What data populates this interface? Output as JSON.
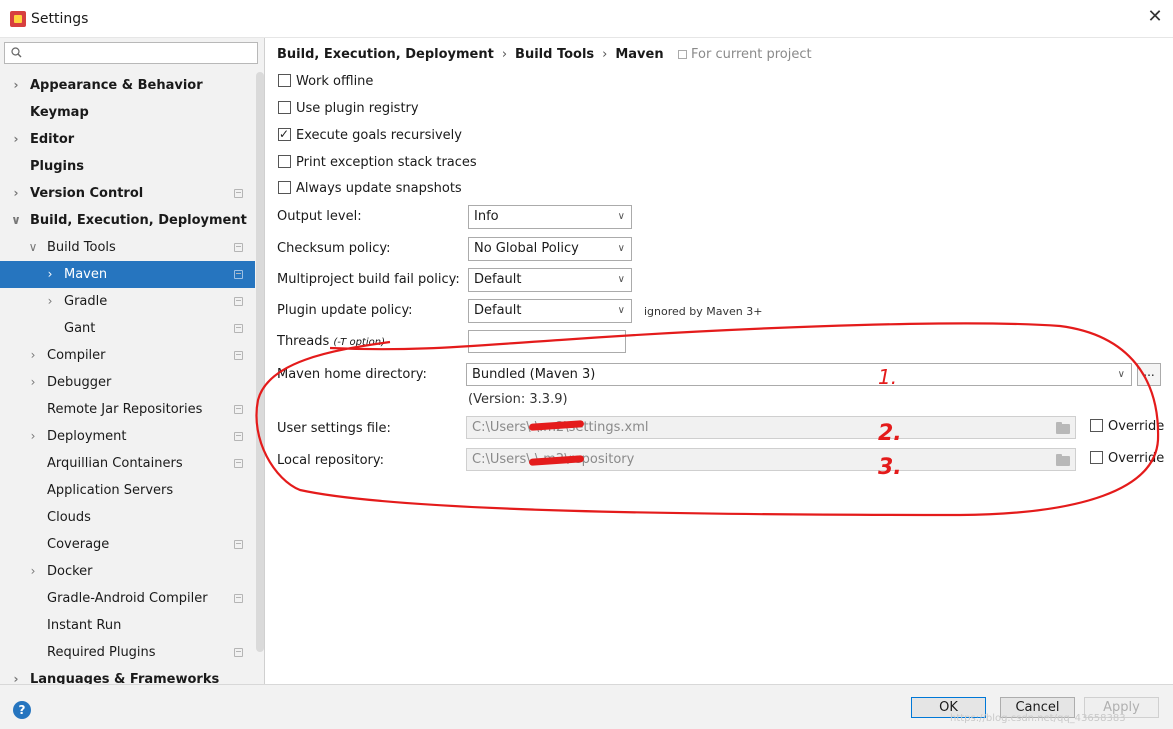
{
  "window": {
    "title": "Settings",
    "close_glyph": "✕"
  },
  "sidebar": {
    "search_placeholder": "",
    "items": [
      {
        "label": "Appearance & Behavior",
        "arrow": "›",
        "bold": true,
        "indent": 0
      },
      {
        "label": "Keymap",
        "arrow": "",
        "bold": true,
        "indent": 0
      },
      {
        "label": "Editor",
        "arrow": "›",
        "bold": true,
        "indent": 0
      },
      {
        "label": "Plugins",
        "arrow": "",
        "bold": true,
        "indent": 0
      },
      {
        "label": "Version Control",
        "arrow": "›",
        "bold": true,
        "indent": 0,
        "project": true
      },
      {
        "label": "Build, Execution, Deployment",
        "arrow": "⌄",
        "bold": true,
        "indent": 0
      },
      {
        "label": "Build Tools",
        "arrow": "⌄",
        "bold": false,
        "indent": 1,
        "project": true
      },
      {
        "label": "Maven",
        "arrow": "›",
        "bold": false,
        "indent": 2,
        "project": true,
        "selected": true
      },
      {
        "label": "Gradle",
        "arrow": "›",
        "bold": false,
        "indent": 2,
        "project": true
      },
      {
        "label": "Gant",
        "arrow": "",
        "bold": false,
        "indent": 2,
        "project": true
      },
      {
        "label": "Compiler",
        "arrow": "›",
        "bold": false,
        "indent": 1,
        "project": true
      },
      {
        "label": "Debugger",
        "arrow": "›",
        "bold": false,
        "indent": 1
      },
      {
        "label": "Remote Jar Repositories",
        "arrow": "",
        "bold": false,
        "indent": 1,
        "project": true
      },
      {
        "label": "Deployment",
        "arrow": "›",
        "bold": false,
        "indent": 1,
        "project": true
      },
      {
        "label": "Arquillian Containers",
        "arrow": "",
        "bold": false,
        "indent": 1,
        "project": true
      },
      {
        "label": "Application Servers",
        "arrow": "",
        "bold": false,
        "indent": 1
      },
      {
        "label": "Clouds",
        "arrow": "",
        "bold": false,
        "indent": 1
      },
      {
        "label": "Coverage",
        "arrow": "",
        "bold": false,
        "indent": 1,
        "project": true
      },
      {
        "label": "Docker",
        "arrow": "›",
        "bold": false,
        "indent": 1
      },
      {
        "label": "Gradle-Android Compiler",
        "arrow": "",
        "bold": false,
        "indent": 1,
        "project": true
      },
      {
        "label": "Instant Run",
        "arrow": "",
        "bold": false,
        "indent": 1
      },
      {
        "label": "Required Plugins",
        "arrow": "",
        "bold": false,
        "indent": 1,
        "project": true
      },
      {
        "label": "Languages & Frameworks",
        "arrow": "›",
        "bold": true,
        "indent": 0
      }
    ]
  },
  "breadcrumb": {
    "part1": "Build, Execution, Deployment",
    "part2": "Build Tools",
    "part3": "Maven",
    "separator": "›",
    "for_project": "For current project"
  },
  "checkboxes": [
    {
      "label": "Work offline",
      "checked": false
    },
    {
      "label": "Use plugin registry",
      "checked": false
    },
    {
      "label": "Execute goals recursively",
      "checked": true
    },
    {
      "label": "Print exception stack traces",
      "checked": false
    },
    {
      "label": "Always update snapshots",
      "checked": false
    }
  ],
  "form": {
    "output_level_label": "Output level:",
    "output_level_value": "Info",
    "checksum_label": "Checksum policy:",
    "checksum_value": "No Global Policy",
    "multiproject_label": "Multiproject build fail policy:",
    "multiproject_value": "Default",
    "plugin_update_label": "Plugin update policy:",
    "plugin_update_value": "Default",
    "plugin_update_hint": "ignored by Maven 3+",
    "threads_label": "Threads",
    "threads_hint": "(-T option)",
    "threads_value": "",
    "maven_home_label": "Maven home directory:",
    "maven_home_value": "Bundled (Maven 3)",
    "more_button": "...",
    "version_text": "(Version: 3.3.9)",
    "user_settings_label": "User settings file:",
    "user_settings_value": "C:\\Users\\        \\.m2\\settings.xml",
    "local_repo_label": "Local repository:",
    "local_repo_value": "C:\\Users\\        \\.m2\\repository",
    "override_label": "Override"
  },
  "annotations": {
    "n1": "1.",
    "n2": "2.",
    "n3": "3.",
    "color": "#e41b1b"
  },
  "footer": {
    "help": "?",
    "ok": "OK",
    "cancel": "Cancel",
    "apply": "Apply",
    "watermark": "https://blog.csdn.net/qq_43658383"
  }
}
